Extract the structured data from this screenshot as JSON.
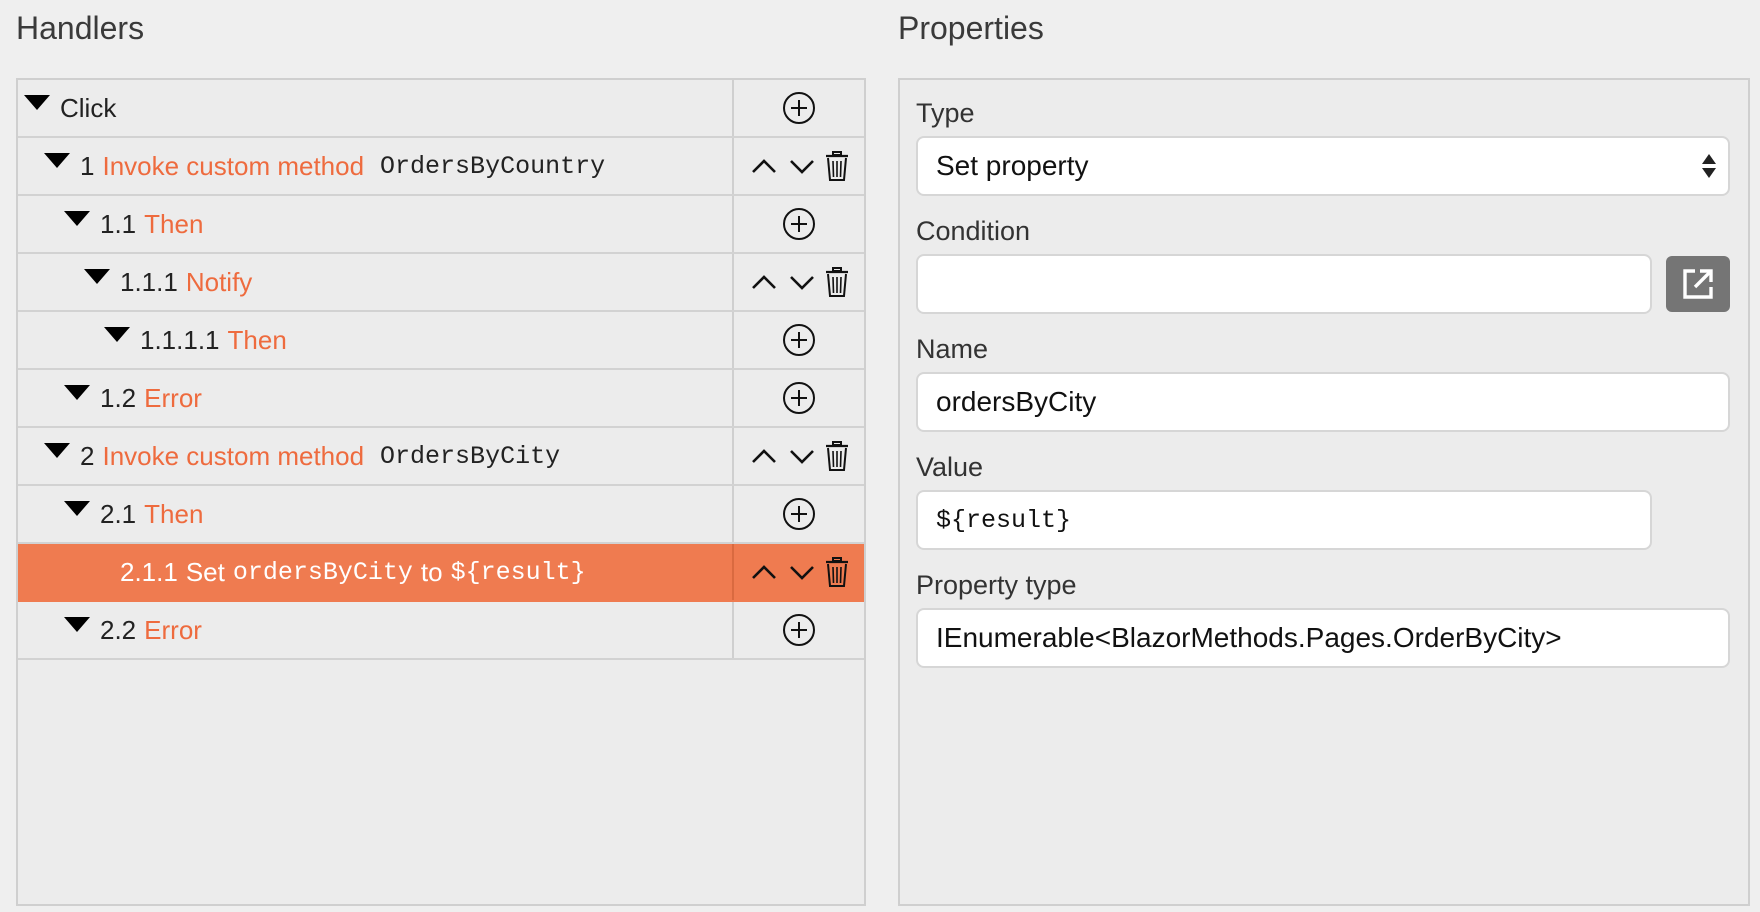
{
  "handlers": {
    "title": "Handlers",
    "rows": [
      {
        "num": "",
        "kw": "",
        "code": "",
        "plain": "Click",
        "actions": "add"
      },
      {
        "num": "1",
        "kw": "Invoke custom method",
        "code": "OrdersByCountry",
        "plain": "",
        "actions": "move"
      },
      {
        "num": "1.1",
        "kw": "Then",
        "code": "",
        "plain": "",
        "actions": "add"
      },
      {
        "num": "1.1.1",
        "kw": "Notify",
        "code": "",
        "plain": "",
        "actions": "move"
      },
      {
        "num": "1.1.1.1",
        "kw": "Then",
        "code": "",
        "plain": "",
        "actions": "add"
      },
      {
        "num": "1.2",
        "kw": "Error",
        "code": "",
        "plain": "",
        "actions": "add"
      },
      {
        "num": "2",
        "kw": "Invoke custom method",
        "code": "OrdersByCity",
        "plain": "",
        "actions": "move"
      },
      {
        "num": "2.1",
        "kw": "Then",
        "code": "",
        "plain": "",
        "actions": "add"
      },
      {
        "num": "2.1.1",
        "set_word": "Set",
        "code": "ordersByCity",
        "to_word": "to",
        "value": "${result}",
        "actions": "move",
        "selected": true
      },
      {
        "num": "2.2",
        "kw": "Error",
        "code": "",
        "plain": "",
        "actions": "add"
      }
    ]
  },
  "properties": {
    "title": "Properties",
    "type_label": "Type",
    "type_value": "Set property",
    "condition_label": "Condition",
    "condition_value": "",
    "name_label": "Name",
    "name_value": "ordersByCity",
    "value_label": "Value",
    "value_value": "${result}",
    "property_type_label": "Property type",
    "property_type_value": "IEnumerable<BlazorMethods.Pages.OrderByCity>"
  },
  "icons": {
    "add": "plus-circle-icon",
    "up": "chevron-up-icon",
    "down": "chevron-down-icon",
    "delete": "trash-icon",
    "external": "external-link-icon",
    "expand": "triangle-down-icon"
  },
  "colors": {
    "accent": "#ef7b50",
    "keyword": "#ee6b3e",
    "external_button": "#757575"
  }
}
